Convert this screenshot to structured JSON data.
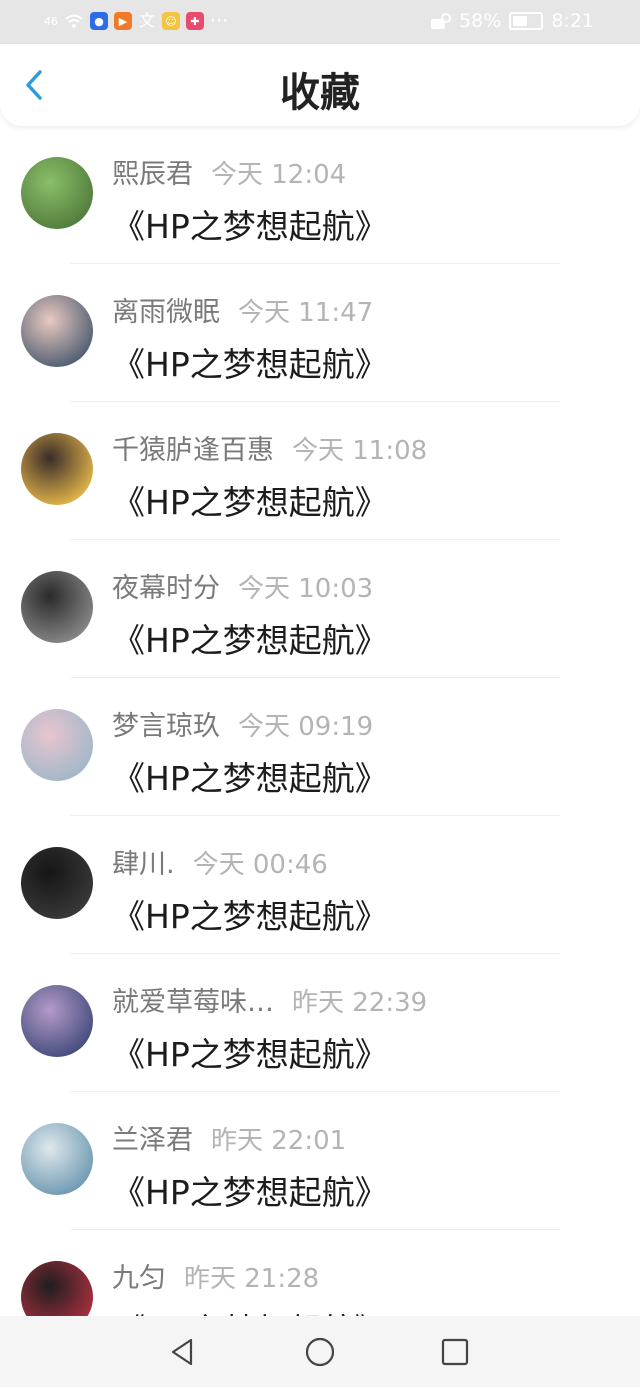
{
  "status_bar": {
    "signal": "46",
    "battery": "58%",
    "time": "8:21",
    "dots": "···"
  },
  "header": {
    "title": "收藏",
    "back_icon": "back-chevron-icon",
    "accent": "#2d9cdb"
  },
  "items": [
    {
      "name": "熙辰君",
      "time": "今天 12:04",
      "content": "《HP之梦想起航》",
      "avatar_colors": [
        "#8bbf6a",
        "#4f7a3a"
      ]
    },
    {
      "name": "离雨微眠",
      "time": "今天 11:47",
      "content": "《HP之梦想起航》",
      "avatar_colors": [
        "#e9c9c0",
        "#4a5a70"
      ]
    },
    {
      "name": "千猿胪逢百惠",
      "time": "今天 11:08",
      "content": "《HP之梦想起航》",
      "avatar_colors": [
        "#3a2c2a",
        "#e8b94a"
      ]
    },
    {
      "name": "夜幕时分",
      "time": "今天 10:03",
      "content": "《HP之梦想起航》",
      "avatar_colors": [
        "#2a2a2a",
        "#8a8a8a"
      ]
    },
    {
      "name": "梦言琼玖",
      "time": "今天 09:19",
      "content": "《HP之梦想起航》",
      "avatar_colors": [
        "#e8c5cf",
        "#9fb7c8"
      ]
    },
    {
      "name": "肆川.",
      "time": "今天 00:46",
      "content": "《HP之梦想起航》",
      "avatar_colors": [
        "#151515",
        "#3a3a3a"
      ]
    },
    {
      "name": "就爱草莓味…",
      "time": "昨天 22:39",
      "content": "《HP之梦想起航》",
      "avatar_colors": [
        "#b49ac8",
        "#3f4a7a"
      ]
    },
    {
      "name": "兰泽君",
      "time": "昨天 22:01",
      "content": "《HP之梦想起航》",
      "avatar_colors": [
        "#dfe8ec",
        "#6a97b0"
      ]
    },
    {
      "name": "九匀",
      "time": "昨天 21:28",
      "content": "《HP之梦想起航》",
      "avatar_colors": [
        "#1e1e1e",
        "#b03040"
      ]
    }
  ],
  "nav": {
    "back": "nav-back-icon",
    "home": "nav-home-icon",
    "recents": "nav-recents-icon"
  }
}
